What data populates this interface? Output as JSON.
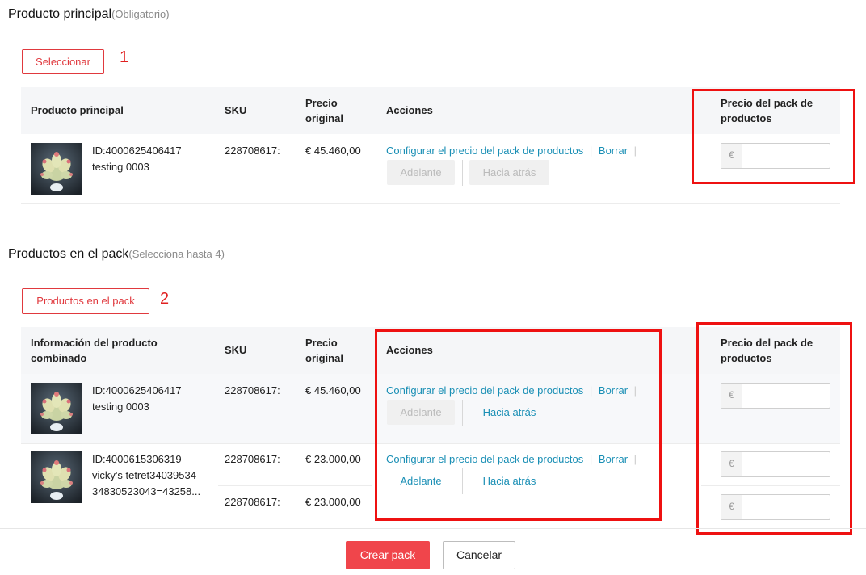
{
  "main_product": {
    "title": "Producto principal",
    "note": "(Obligatorio)",
    "select_button": "Seleccionar",
    "marker": "1",
    "headers": {
      "product": "Producto principal",
      "sku": "SKU",
      "price_line1": "Precio",
      "price_line2": "original",
      "actions": "Acciones",
      "pack_price_line1": "Precio del pack de",
      "pack_price_line2": "productos"
    },
    "row": {
      "id": "ID:4000625406417",
      "name": "testing 0003",
      "sku": "228708617:",
      "price": "€ 45.460,00",
      "configure": "Configurar el precio del pack de productos",
      "delete": "Borrar",
      "forward": "Adelante",
      "back": "Hacia atrás",
      "currency": "€"
    }
  },
  "pack_products": {
    "title": "Productos en el pack",
    "note": "(Selecciona hasta 4)",
    "select_button": "Productos en el pack",
    "marker": "2",
    "headers": {
      "product_line1": "Información del producto",
      "product_line2": "combinado",
      "sku": "SKU",
      "price_line1": "Precio",
      "price_line2": "original",
      "actions": "Acciones",
      "pack_price_line1": "Precio del pack de",
      "pack_price_line2": "productos"
    },
    "rows": [
      {
        "id": "ID:4000625406417",
        "name": "testing 0003",
        "sku": "228708617:",
        "price": "€ 45.460,00",
        "configure": "Configurar el precio del pack de productos",
        "delete": "Borrar",
        "forward": "Adelante",
        "back": "Hacia atrás",
        "currency": "€"
      },
      {
        "id": "ID:4000615306319",
        "name_line1": "vicky's tetret34039534",
        "name_line2": "34830523043=43258...",
        "sku": "228708617:",
        "price": "€ 23.000,00",
        "sku2": "228708617:",
        "price2": "€ 23.000,00",
        "configure": "Configurar el precio del pack de productos",
        "delete": "Borrar",
        "forward": "Adelante",
        "back": "Hacia atrás",
        "currency": "€",
        "currency2": "€"
      }
    ]
  },
  "footer": {
    "create": "Crear pack",
    "cancel": "Cancelar"
  },
  "colors": {
    "accent": "#f0454b",
    "link": "#1a8fb5",
    "annotation": "#ee1111"
  }
}
